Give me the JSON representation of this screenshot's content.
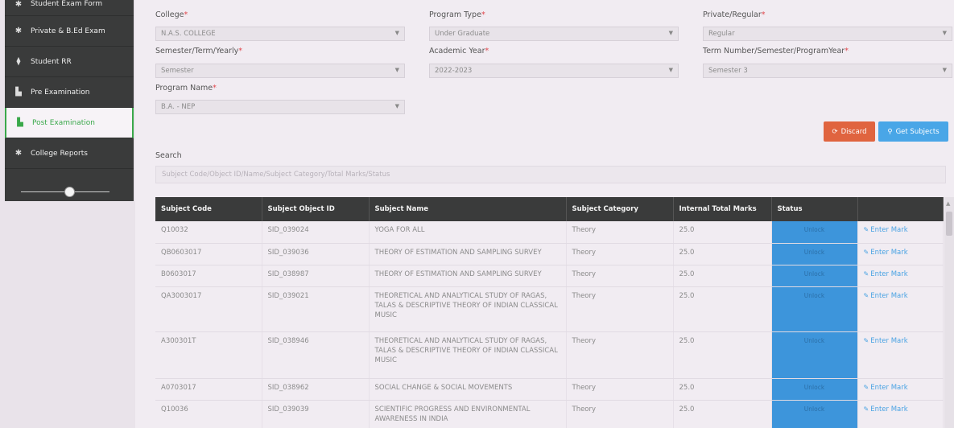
{
  "sidebar": {
    "items": [
      {
        "icon": "asterisk-icon",
        "glyph": "✱",
        "label": "Student Exam Form"
      },
      {
        "icon": "asterisk-icon",
        "glyph": "✱",
        "label": "Private & B.Ed Exam"
      },
      {
        "icon": "pin-icon",
        "glyph": "⧫",
        "label": "Student RR"
      },
      {
        "icon": "copy-icon",
        "glyph": "▙",
        "label": "Pre Examination"
      },
      {
        "icon": "copy-icon",
        "glyph": "▙",
        "label": "Post Examination"
      },
      {
        "icon": "asterisk-icon",
        "glyph": "✱",
        "label": "College Reports"
      }
    ]
  },
  "form": {
    "college_label": "College",
    "college_value": "N.A.S. COLLEGE",
    "program_type_label": "Program Type",
    "program_type_value": "Under Graduate",
    "private_regular_label": "Private/Regular",
    "private_regular_value": "Regular",
    "semester_label": "Semester/Term/Yearly",
    "semester_value": "Semester",
    "academic_year_label": "Academic Year",
    "academic_year_value": "2022-2023",
    "term_number_label": "Term Number/Semester/ProgramYear",
    "term_number_value": "Semester 3",
    "program_name_label": "Program Name",
    "program_name_value": "B.A. - NEP",
    "required_mark": "*",
    "caret": "▼"
  },
  "buttons": {
    "discard_icon": "⟳",
    "discard_label": "Discard",
    "get_subjects_icon": "⚲",
    "get_subjects_label": "Get Subjects"
  },
  "search": {
    "label": "Search",
    "placeholder": "Subject Code/Object ID/Name/Subject Category/Total Marks/Status"
  },
  "table": {
    "headers": [
      "Subject Code",
      "Subject Object ID",
      "Subject Name",
      "Subject Category",
      "Internal Total Marks",
      "Status",
      ""
    ],
    "action_label": "Enter Mark",
    "action_icon": "✎",
    "rows": [
      {
        "code": "Q10032",
        "object_id": "SID_039024",
        "name": "YOGA FOR ALL",
        "category": "Theory",
        "marks": "25.0",
        "status": "Unlock"
      },
      {
        "code": "QB0603017",
        "object_id": "SID_039036",
        "name": "THEORY OF ESTIMATION AND SAMPLING SURVEY",
        "category": "Theory",
        "marks": "25.0",
        "status": "Unlock"
      },
      {
        "code": "B0603017",
        "object_id": "SID_038987",
        "name": "THEORY OF ESTIMATION AND SAMPLING SURVEY",
        "category": "Theory",
        "marks": "25.0",
        "status": "Unlock"
      },
      {
        "code": "QA3003017",
        "object_id": "SID_039021",
        "name": "THEORETICAL AND ANALYTICAL STUDY OF RAGAS, TALAS & DESCRIPTIVE THEORY OF INDIAN CLASSICAL MUSIC",
        "category": "Theory",
        "marks": "25.0",
        "status": "Unlock"
      },
      {
        "code": "A300301T",
        "object_id": "SID_038946",
        "name": "THEORETICAL AND ANALYTICAL STUDY OF RAGAS, TALAS & DESCRIPTIVE THEORY OF INDIAN CLASSICAL MUSIC",
        "category": "Theory",
        "marks": "25.0",
        "status": "Unlock"
      },
      {
        "code": "A0703017",
        "object_id": "SID_038962",
        "name": "SOCIAL CHANGE & SOCIAL MOVEMENTS",
        "category": "Theory",
        "marks": "25.0",
        "status": "Unlock"
      },
      {
        "code": "Q10036",
        "object_id": "SID_039039",
        "name": "SCIENTIFIC PROGRESS AND ENVIRONMENTAL AWARENESS IN INDIA",
        "category": "Theory",
        "marks": "25.0",
        "status": "Unlock"
      }
    ]
  },
  "colors": {
    "sidebar_bg": "#3a3b3b",
    "active_green": "#3aa84a",
    "discard": "#e0643f",
    "get_subjects": "#49a6e7",
    "status_blue": "#3d95db",
    "required_red": "#e0474c"
  }
}
